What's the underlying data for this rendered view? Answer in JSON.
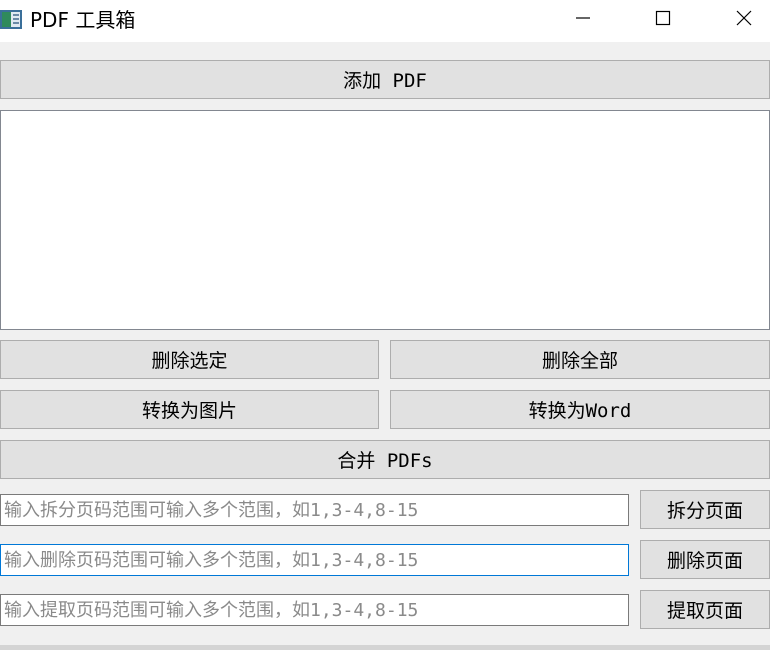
{
  "window": {
    "title": "PDF 工具箱",
    "controls": [
      "minimize-icon",
      "maximize-icon",
      "close-icon"
    ]
  },
  "actions": {
    "add_pdf": "添加 PDF",
    "delete_selected": "删除选定",
    "delete_all": "删除全部",
    "convert_image": "转换为图片",
    "convert_word": "转换为Word",
    "merge": "合并 PDFs"
  },
  "page_ops": {
    "split": {
      "placeholder": "输入拆分页码范围可输入多个范围，如1,3-4,8-15",
      "button": "拆分页面"
    },
    "delete": {
      "placeholder": "输入删除页码范围可输入多个范围，如1,3-4,8-15",
      "button": "删除页面"
    },
    "extract": {
      "placeholder": "输入提取页码范围可输入多个范围，如1,3-4,8-15",
      "button": "提取页面"
    }
  },
  "colors": {
    "button_bg": "#e1e1e1",
    "button_border": "#adadad",
    "focus_border": "#0078d7",
    "window_bg": "#f0f0f0"
  }
}
